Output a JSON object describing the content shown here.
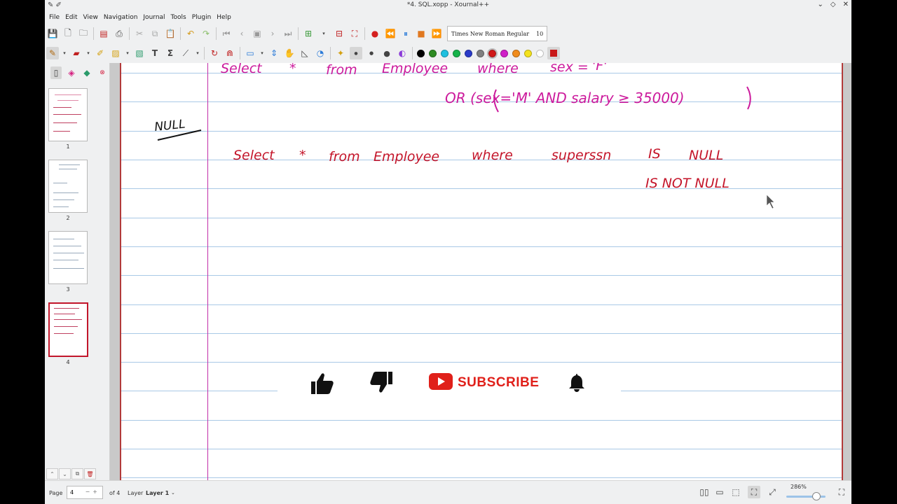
{
  "window": {
    "title": "*4. SQL.xopp - Xournal++"
  },
  "menu": {
    "items": [
      "File",
      "Edit",
      "View",
      "Navigation",
      "Journal",
      "Tools",
      "Plugin",
      "Help"
    ]
  },
  "toolbar": {
    "font_name": "Times New Roman Regular",
    "font_size": "10",
    "pen_colors": [
      "#000000",
      "#2e8b22",
      "#1fc0e0",
      "#16b34a",
      "#2a3bc8",
      "#808080",
      "#d01818",
      "#d020c8",
      "#f08c1c",
      "#f4e21c",
      "#ffffff"
    ],
    "active_color": "#c81818"
  },
  "sidebar": {
    "pages": [
      {
        "number": "1",
        "selected": false
      },
      {
        "number": "2",
        "selected": false
      },
      {
        "number": "3",
        "selected": false
      },
      {
        "number": "4",
        "selected": true
      }
    ]
  },
  "canvas": {
    "margin_label": "NULL",
    "query_line1_part1": "Select",
    "query_line1_part2": "*",
    "query_line1_part3": "from",
    "query_line1_part4": "Employee",
    "query_line1_part5": "where",
    "query_line1_part6": "sex =",
    "query_line1_part7": "'F'",
    "query_line2": "OR (sex='M' AND salary ≥ 35000)",
    "query2_part1": "Select",
    "query2_part2": "*",
    "query2_part3": "from",
    "query2_part4": "Employee",
    "query2_part5": "where",
    "query2_part6": "superssn",
    "query2_part7": "IS",
    "query2_part8": "NULL",
    "query3": "IS NOT NULL"
  },
  "overlay": {
    "subscribe_label": "SUBSCRIBE"
  },
  "status": {
    "page_label": "Page",
    "page_value": "4",
    "page_total": "of 4",
    "layer_label": "Layer",
    "layer_value": "Layer 1",
    "zoom": "286%"
  }
}
